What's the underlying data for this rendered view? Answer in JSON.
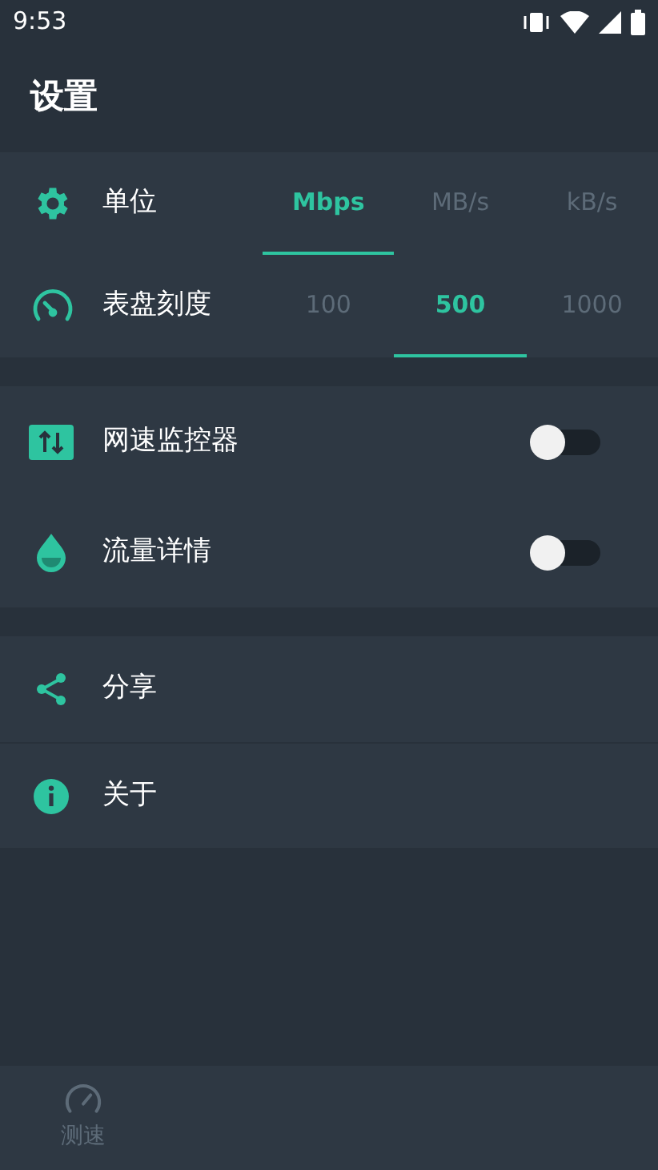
{
  "status_bar": {
    "time": "9:53"
  },
  "title": "设置",
  "option_rows": [
    {
      "label": "单位",
      "options": [
        {
          "label": "Mbps",
          "selected": true
        },
        {
          "label": "MB/s",
          "selected": false
        },
        {
          "label": "kB/s",
          "selected": false
        }
      ]
    },
    {
      "label": "表盘刻度",
      "options": [
        {
          "label": "100",
          "selected": false
        },
        {
          "label": "500",
          "selected": true
        },
        {
          "label": "1000",
          "selected": false
        }
      ]
    }
  ],
  "toggle_rows": [
    {
      "label": "网速监控器",
      "on": false
    },
    {
      "label": "流量详情",
      "on": false
    }
  ],
  "link_rows": [
    {
      "label": "分享"
    },
    {
      "label": "关于"
    }
  ],
  "bottom_nav": [
    {
      "label": "测速",
      "selected": false
    }
  ]
}
